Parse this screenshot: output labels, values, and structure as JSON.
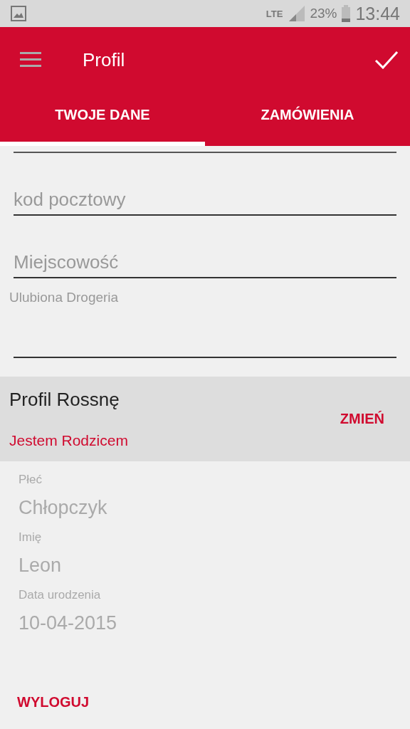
{
  "status_bar": {
    "network": "LTE",
    "battery": "23%",
    "time": "13:44"
  },
  "toolbar": {
    "title": "Profil"
  },
  "tabs": [
    {
      "label": "TWOJE DANE",
      "selected": true
    },
    {
      "label": "ZAMÓWIENIA",
      "selected": false
    }
  ],
  "fields": [
    {
      "placeholder": "kod pocztowy"
    },
    {
      "placeholder": "Miejscowość"
    }
  ],
  "favorite_store": {
    "label": "Ulubiona Drogeria"
  },
  "profile_section": {
    "title": "Profil Rossnę",
    "subtitle": "Jestem Rodzicem",
    "action": "ZMIEŃ"
  },
  "child_fields": [
    {
      "label": "Płeć",
      "value": "Chłopczyk"
    },
    {
      "label": "Imię",
      "value": "Leon"
    },
    {
      "label": "Data urodzenia",
      "value": "10-04-2015"
    }
  ],
  "logout": "WYLOGUJ"
}
